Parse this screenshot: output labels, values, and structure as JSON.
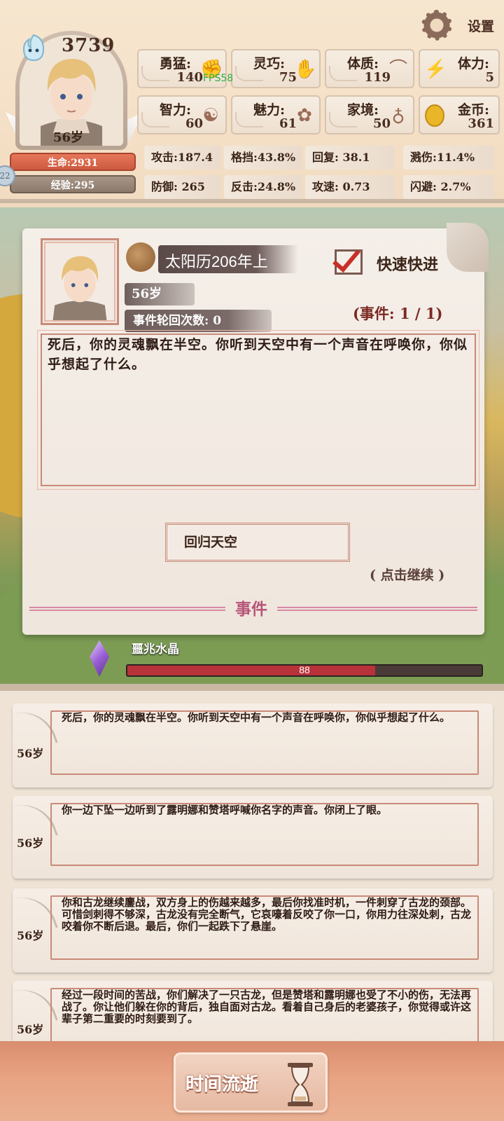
{
  "header": {
    "settings_label": "设置",
    "score": "3739",
    "age": "56岁",
    "hp": "生命:2931",
    "xp": "经验:295",
    "level": "22",
    "fps": "FPS58",
    "stats": [
      {
        "label": "勇猛:",
        "value": "140",
        "icon": "fist-icon"
      },
      {
        "label": "灵巧:",
        "value": "75",
        "icon": "hand-icon"
      },
      {
        "label": "体质:",
        "value": "119",
        "icon": "muscle-icon"
      },
      {
        "label": "智力:",
        "value": "60",
        "icon": "brain-icon"
      },
      {
        "label": "魅力:",
        "value": "61",
        "icon": "flower-icon"
      },
      {
        "label": "家境:",
        "value": "50",
        "icon": "money-bag-icon"
      }
    ],
    "energy": {
      "label": "体力:",
      "value": "5"
    },
    "gold": {
      "label": "金币:",
      "value": "361"
    },
    "combat": [
      "攻击:187.4",
      "格挡:43.8%",
      "回复: 38.1",
      "溅伤:11.4%",
      "防御: 265",
      "反击:24.8%",
      "攻速: 0.73",
      "闪避: 2.7%"
    ]
  },
  "event": {
    "date": "太阳历206年上",
    "fast_label": "快速快进",
    "age": "56岁",
    "cycle_label": "事件轮回次数:",
    "cycle_value": "0",
    "count": "(事件: 1 / 1)",
    "text": "死后，你的灵魂飘在半空。你听到天空中有一个声音在呼唤你，你似乎想起了什么。",
    "choice": "回归天空",
    "continue": "( 点击继续 )",
    "section_label": "事件"
  },
  "crystal": {
    "name": "噩兆水晶",
    "value": "88",
    "fill_fraction": 0.7
  },
  "log": [
    {
      "age": "56岁",
      "text": "死后，你的灵魂飘在半空。你听到天空中有一个声音在呼唤你，你似乎想起了什么。"
    },
    {
      "age": "56岁",
      "text": "你一边下坠一边听到了露明娜和赞塔呼喊你名字的声音。你闭上了眼。"
    },
    {
      "age": "56岁",
      "text": "你和古龙继续鏖战，双方身上的伤越来越多，最后你找准时机，一件刺穿了古龙的颈部。可惜剑刺得不够深，古龙没有完全断气，它哀嚎着反咬了你一口，你用力往深处刺，古龙咬着你不断后退。最后，你们一起跌下了悬崖。"
    },
    {
      "age": "56岁",
      "text": "经过一段时间的苦战，你们解决了一只古龙，但是赞塔和露明娜也受了不小的伤，无法再战了。你让他们躲在你的背后，独自面对古龙。看着自己身后的老婆孩子，你觉得或许这辈子第二重要的时刻要到了。"
    }
  ],
  "bottom": {
    "time_label": "时间流逝"
  },
  "colors": {
    "accent_red": "#c8302a",
    "hp": "#cc5a3f",
    "events_pink": "#b65478",
    "crystal_bar": "#b8323a"
  }
}
